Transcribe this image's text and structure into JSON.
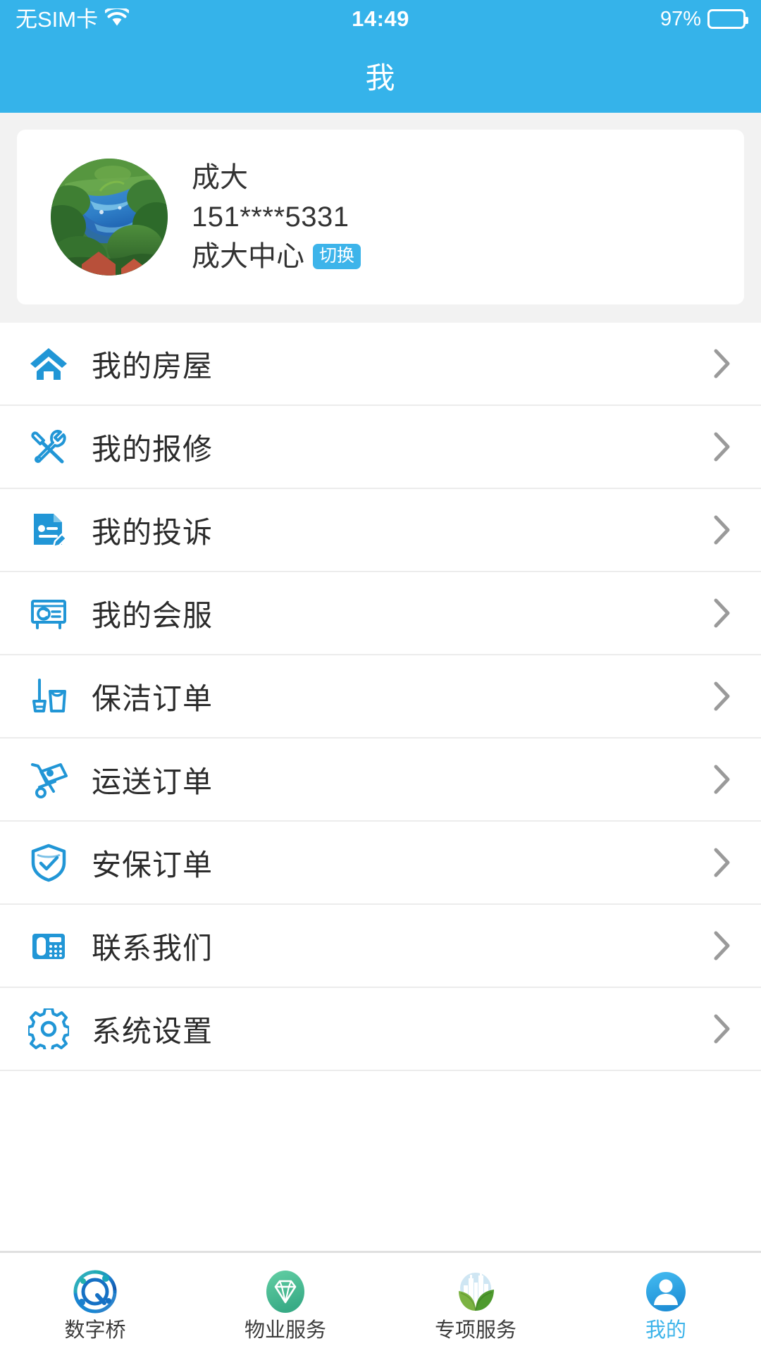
{
  "statusbar": {
    "carrier": "无SIM卡",
    "wifi_icon": "wifi-icon",
    "time": "14:49",
    "battery_percent": "97%",
    "battery_level": 97
  },
  "header": {
    "title": "我",
    "background_color": "#35b3ea"
  },
  "profile": {
    "avatar_icon": "avatar-photo",
    "name": "成大",
    "phone": "151****5331",
    "organization": "成大中心",
    "switch_label": "切换",
    "switch_color": "#3db4ea"
  },
  "menu": {
    "items": [
      {
        "label": "我的房屋",
        "icon": "home-icon",
        "chevron": "chevron-right-icon"
      },
      {
        "label": "我的报修",
        "icon": "wrench-screwdriver-icon",
        "chevron": "chevron-right-icon"
      },
      {
        "label": "我的投诉",
        "icon": "document-pencil-icon",
        "chevron": "chevron-right-icon"
      },
      {
        "label": "我的会服",
        "icon": "projector-screen-icon",
        "chevron": "chevron-right-icon"
      },
      {
        "label": "保洁订单",
        "icon": "mop-bucket-icon",
        "chevron": "chevron-right-icon"
      },
      {
        "label": "运送订单",
        "icon": "hand-truck-icon",
        "chevron": "chevron-right-icon"
      },
      {
        "label": "安保订单",
        "icon": "shield-check-icon",
        "chevron": "chevron-right-icon"
      },
      {
        "label": "联系我们",
        "icon": "desk-phone-icon",
        "chevron": "chevron-right-icon"
      },
      {
        "label": "系统设置",
        "icon": "gear-icon",
        "chevron": "chevron-right-icon"
      }
    ],
    "accent_color": "#2196d6"
  },
  "tabbar": {
    "active_color": "#3db4ea",
    "inactive_color": "#3c3c3c",
    "tabs": [
      {
        "label": "数字桥",
        "icon": "digital-bridge-logo-icon",
        "active": false
      },
      {
        "label": "物业服务",
        "icon": "diamond-circle-icon",
        "active": false
      },
      {
        "label": "专项服务",
        "icon": "leaves-city-icon",
        "active": false
      },
      {
        "label": "我的",
        "icon": "person-circle-icon",
        "active": true
      }
    ]
  }
}
